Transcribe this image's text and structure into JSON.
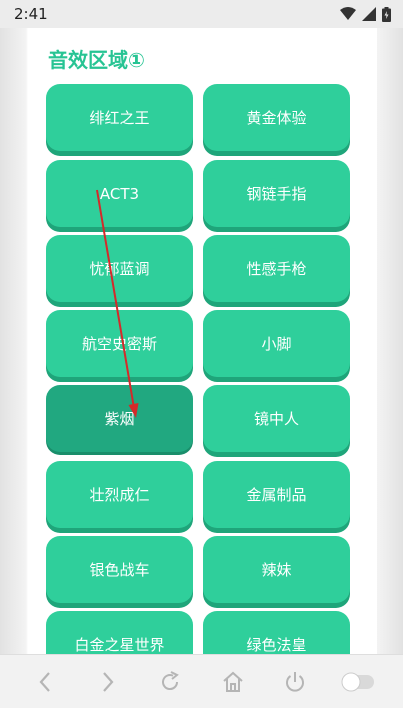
{
  "status_bar": {
    "time": "2:41",
    "icons": [
      "wifi-icon",
      "cell-signal-icon",
      "battery-icon"
    ]
  },
  "section": {
    "title": "音效区域①"
  },
  "buttons": [
    {
      "label": "绯红之王",
      "pressed": false
    },
    {
      "label": "黄金体验",
      "pressed": false
    },
    {
      "label": "ACT3",
      "pressed": false
    },
    {
      "label": "钢链手指",
      "pressed": false
    },
    {
      "label": "忧郁蓝调",
      "pressed": false
    },
    {
      "label": "性感手枪",
      "pressed": false
    },
    {
      "label": "航空史密斯",
      "pressed": false
    },
    {
      "label": "小脚",
      "pressed": false
    },
    {
      "label": "紫烟",
      "pressed": true
    },
    {
      "label": "镜中人",
      "pressed": false
    },
    {
      "label": "壮烈成仁",
      "pressed": false
    },
    {
      "label": "金属制品",
      "pressed": false
    },
    {
      "label": "银色战车",
      "pressed": false
    },
    {
      "label": "辣妹",
      "pressed": false
    },
    {
      "label": "白金之星世界",
      "pressed": false
    },
    {
      "label": "绿色法皇",
      "pressed": false
    }
  ],
  "nav_bar": {
    "items": [
      "back-icon",
      "forward-icon",
      "refresh-icon",
      "home-icon",
      "power-icon",
      "toggle-icon"
    ]
  },
  "colors": {
    "accent": "#27c493",
    "button": "#2fcf9b",
    "button_pressed": "#21a880",
    "annotation_arrow": "#d42a2a"
  }
}
